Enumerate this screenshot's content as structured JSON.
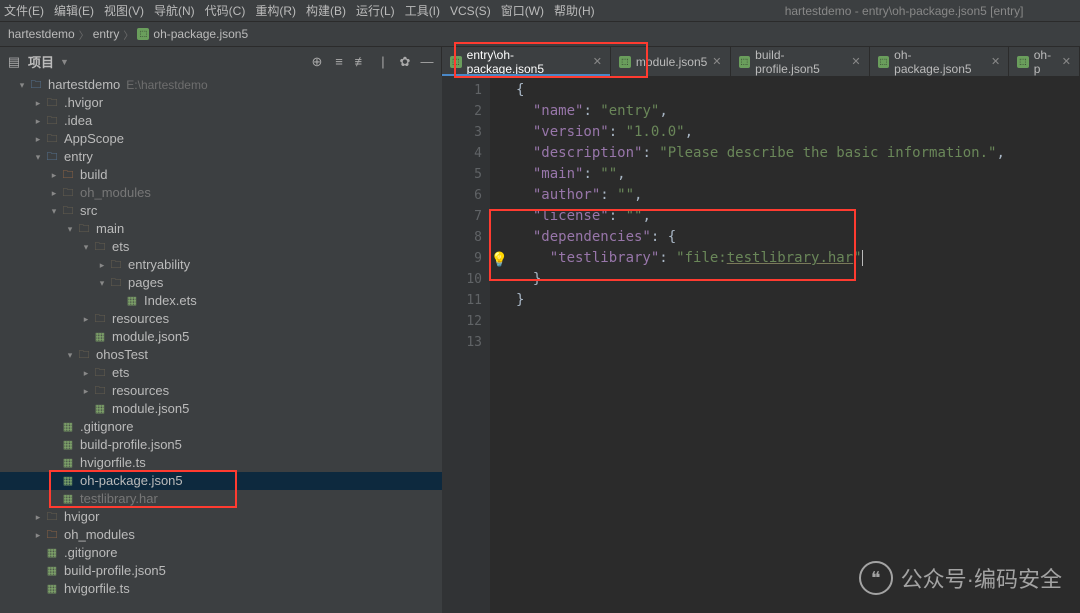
{
  "menubar": {
    "items": [
      "文件(E)",
      "编辑(E)",
      "视图(V)",
      "导航(N)",
      "代码(C)",
      "重构(R)",
      "构建(B)",
      "运行(L)",
      "工具(I)",
      "VCS(S)",
      "窗口(W)",
      "帮助(H)"
    ],
    "context_title": "hartestdemo - entry\\oh-package.json5 [entry]"
  },
  "breadcrumbs": {
    "items": [
      "hartestdemo",
      "entry",
      "oh-package.json5"
    ]
  },
  "project_header": {
    "label": "项目",
    "icons": [
      "target-icon",
      "collapse-icon",
      "expand-icon",
      "divider",
      "settings-icon",
      "hide-icon"
    ]
  },
  "editor_tabs": [
    {
      "label": "entry\\oh-package.json5",
      "active": true
    },
    {
      "label": "module.json5",
      "active": false
    },
    {
      "label": "build-profile.json5",
      "active": false
    },
    {
      "label": "oh-package.json5",
      "active": false
    },
    {
      "label": "oh-p",
      "active": false
    }
  ],
  "project_tree": [
    {
      "depth": 1,
      "twisty": "down",
      "icon": "blue-folder",
      "label": "hartestdemo",
      "sub": "E:\\hartestdemo"
    },
    {
      "depth": 2,
      "twisty": "right",
      "icon": "folder-closed",
      "label": ".hvigor"
    },
    {
      "depth": 2,
      "twisty": "right",
      "icon": "folder-closed",
      "label": ".idea"
    },
    {
      "depth": 2,
      "twisty": "right",
      "icon": "folder-closed",
      "label": "AppScope"
    },
    {
      "depth": 2,
      "twisty": "down",
      "icon": "blue-folder",
      "label": "entry"
    },
    {
      "depth": 3,
      "twisty": "right",
      "icon": "orange-folder",
      "label": "build"
    },
    {
      "depth": 3,
      "twisty": "right",
      "icon": "folder-closed",
      "label": "oh_modules",
      "faded": true
    },
    {
      "depth": 3,
      "twisty": "down",
      "icon": "folder-closed",
      "label": "src"
    },
    {
      "depth": 4,
      "twisty": "down",
      "icon": "folder-closed",
      "label": "main"
    },
    {
      "depth": 5,
      "twisty": "down",
      "icon": "folder-closed",
      "label": "ets"
    },
    {
      "depth": 6,
      "twisty": "right",
      "icon": "folder-closed",
      "label": "entryability"
    },
    {
      "depth": 6,
      "twisty": "down",
      "icon": "folder-closed",
      "label": "pages"
    },
    {
      "depth": 7,
      "twisty": "",
      "icon": "file-ic",
      "label": "Index.ets"
    },
    {
      "depth": 5,
      "twisty": "right",
      "icon": "folder-closed",
      "label": "resources"
    },
    {
      "depth": 5,
      "twisty": "",
      "icon": "file-ic",
      "label": "module.json5"
    },
    {
      "depth": 4,
      "twisty": "down",
      "icon": "folder-closed",
      "label": "ohosTest"
    },
    {
      "depth": 5,
      "twisty": "right",
      "icon": "folder-closed",
      "label": "ets"
    },
    {
      "depth": 5,
      "twisty": "right",
      "icon": "folder-closed",
      "label": "resources"
    },
    {
      "depth": 5,
      "twisty": "",
      "icon": "file-ic",
      "label": "module.json5"
    },
    {
      "depth": 3,
      "twisty": "",
      "icon": "file-ic",
      "label": ".gitignore"
    },
    {
      "depth": 3,
      "twisty": "",
      "icon": "file-ic",
      "label": "build-profile.json5"
    },
    {
      "depth": 3,
      "twisty": "",
      "icon": "file-ic",
      "label": "hvigorfile.ts"
    },
    {
      "depth": 3,
      "twisty": "",
      "icon": "file-ic",
      "label": "oh-package.json5",
      "selected": true
    },
    {
      "depth": 3,
      "twisty": "",
      "icon": "file-ic",
      "label": "testlibrary.har",
      "faded": true
    },
    {
      "depth": 2,
      "twisty": "right",
      "icon": "folder-closed",
      "label": "hvigor"
    },
    {
      "depth": 2,
      "twisty": "right",
      "icon": "orange-folder",
      "label": "oh_modules"
    },
    {
      "depth": 2,
      "twisty": "",
      "icon": "file-ic",
      "label": ".gitignore"
    },
    {
      "depth": 2,
      "twisty": "",
      "icon": "file-ic",
      "label": "build-profile.json5"
    },
    {
      "depth": 2,
      "twisty": "",
      "icon": "file-ic",
      "label": "hvigorfile.ts"
    }
  ],
  "code": {
    "lines": [
      [
        {
          "t": "brace",
          "v": "{"
        }
      ],
      [
        {
          "t": "key",
          "v": "  \"name\""
        },
        {
          "t": "brace",
          "v": ": "
        },
        {
          "t": "str",
          "v": "\"entry\""
        },
        {
          "t": "brace",
          "v": ","
        }
      ],
      [
        {
          "t": "key",
          "v": "  \"version\""
        },
        {
          "t": "brace",
          "v": ": "
        },
        {
          "t": "str",
          "v": "\"1.0.0\""
        },
        {
          "t": "brace",
          "v": ","
        }
      ],
      [
        {
          "t": "key",
          "v": "  \"description\""
        },
        {
          "t": "brace",
          "v": ": "
        },
        {
          "t": "str",
          "v": "\"Please describe the basic information.\""
        },
        {
          "t": "brace",
          "v": ","
        }
      ],
      [
        {
          "t": "key",
          "v": "  \"main\""
        },
        {
          "t": "brace",
          "v": ": "
        },
        {
          "t": "str",
          "v": "\"\""
        },
        {
          "t": "brace",
          "v": ","
        }
      ],
      [
        {
          "t": "key",
          "v": "  \"author\""
        },
        {
          "t": "brace",
          "v": ": "
        },
        {
          "t": "str",
          "v": "\"\""
        },
        {
          "t": "brace",
          "v": ","
        }
      ],
      [
        {
          "t": "key",
          "v": "  \"license\""
        },
        {
          "t": "brace",
          "v": ": "
        },
        {
          "t": "str",
          "v": "\"\""
        },
        {
          "t": "brace",
          "v": ","
        }
      ],
      [
        {
          "t": "key",
          "v": "  \"dependencies\""
        },
        {
          "t": "brace",
          "v": ": {"
        }
      ],
      [
        {
          "t": "key",
          "v": "    \"testlibrary\""
        },
        {
          "t": "brace",
          "v": ": "
        },
        {
          "t": "str",
          "v": "\"file:"
        },
        {
          "t": "und",
          "v": "testlibrary.har"
        },
        {
          "t": "str",
          "v": "\""
        }
      ],
      [
        {
          "t": "brace",
          "v": "  }"
        }
      ],
      [
        {
          "t": "brace",
          "v": "}"
        }
      ],
      [],
      []
    ],
    "line_count": 13
  },
  "watermark": {
    "text": "公众号·编码安全"
  }
}
